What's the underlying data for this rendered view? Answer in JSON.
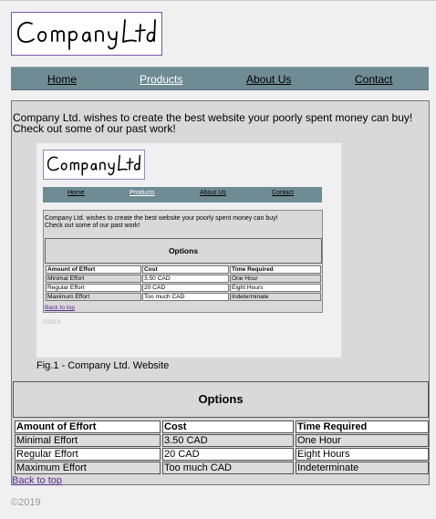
{
  "logo": {
    "text": "Company Ltd"
  },
  "nav": {
    "items": [
      {
        "label": "Home"
      },
      {
        "label": "Products"
      },
      {
        "label": "About Us"
      },
      {
        "label": "Contact"
      }
    ]
  },
  "main": {
    "intro_line1": "Company Ltd. wishes to create the best website your poorly spent money can buy!",
    "intro_line2": "Check out some of our past work!",
    "figure_caption": "Fig.1 - Company Ltd. Website",
    "options_heading": "Options",
    "table": {
      "headers": [
        "Amount of Effort",
        "Cost",
        "Time Required"
      ],
      "rows": [
        [
          "Minimal Effort",
          "3.50 CAD",
          "One Hour"
        ],
        [
          "Regular Effort",
          "20 CAD",
          "Eight Hours"
        ],
        [
          "Maximum Effort",
          "Too much CAD",
          "Indeterminate"
        ]
      ]
    },
    "back_to_top": "Back to top"
  },
  "thumbnail": {
    "copyright": "©2019"
  },
  "footer": {
    "copyright": "©2019"
  }
}
